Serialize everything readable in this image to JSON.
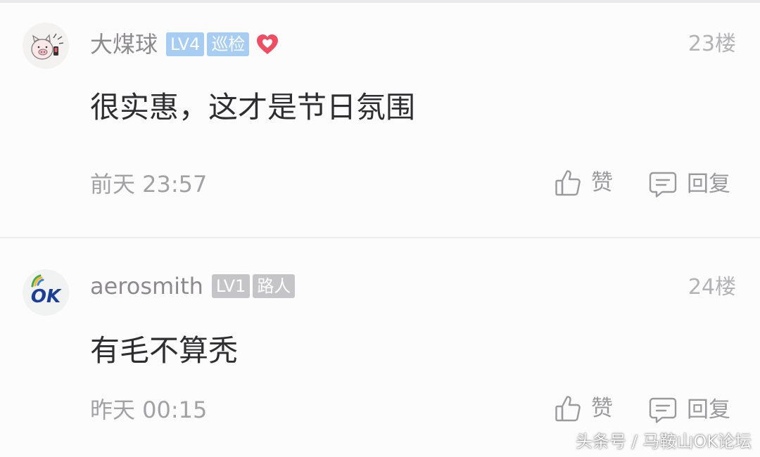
{
  "comments": [
    {
      "username": "大煤球",
      "level_badge": "LV4",
      "role_badge": "巡检",
      "has_heart_icon": true,
      "floor": "23楼",
      "content": "很实惠，这才是节日氛围",
      "time": "前天 23:57",
      "like_label": "赞",
      "reply_label": "回复",
      "avatar_icon": "pig-avatar-icon"
    },
    {
      "username": "aerosmith",
      "level_badge": "LV1",
      "role_badge": "路人",
      "has_heart_icon": false,
      "floor": "24楼",
      "content": "有毛不算秃",
      "time": "昨天 00:15",
      "like_label": "赞",
      "reply_label": "回复",
      "avatar_icon": "ok-logo-avatar-icon",
      "avatar_text": "OK"
    }
  ],
  "watermark": "头条号 / 马鞍山OK论坛",
  "colors": {
    "badge_blue": "#a7cdf3",
    "badge_gray": "#c5c4c6",
    "heart_red": "#ee4d62",
    "text_primary": "#2e2d2f",
    "text_secondary": "#8c8a8d"
  }
}
